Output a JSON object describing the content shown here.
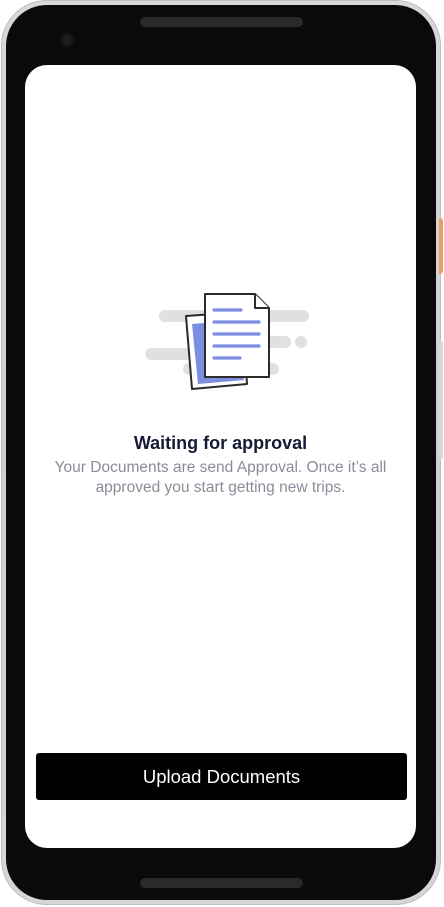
{
  "approval": {
    "title": "Waiting for approval",
    "message": "Your Documents are send Approval. Once it’s all approved you start getting new trips."
  },
  "actions": {
    "upload_label": "Upload Documents"
  },
  "colors": {
    "title": "#161a33",
    "message": "#8a8d99",
    "button_background": "#000000",
    "button_text": "#ffffff",
    "illustration_accent": "#7b8ee0",
    "illustration_lines": "#e0e0e0"
  },
  "icons": {
    "illustration": "documents-pending-illustration"
  }
}
